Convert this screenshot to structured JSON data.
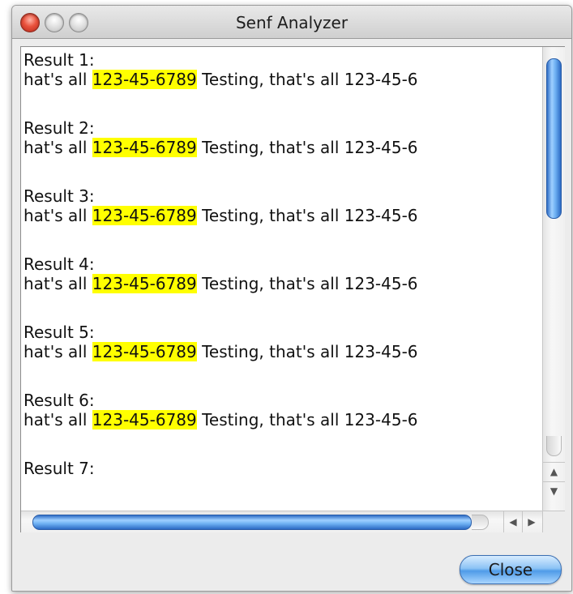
{
  "window": {
    "title": "Senf Analyzer"
  },
  "results": [
    {
      "heading": "Result 1:",
      "prefix": "hat's all ",
      "match": "123-45-6789",
      "suffix": " Testing, that's all 123-45-6"
    },
    {
      "heading": "Result 2:",
      "prefix": "hat's all ",
      "match": "123-45-6789",
      "suffix": " Testing, that's all 123-45-6"
    },
    {
      "heading": "Result 3:",
      "prefix": "hat's all ",
      "match": "123-45-6789",
      "suffix": " Testing, that's all 123-45-6"
    },
    {
      "heading": "Result 4:",
      "prefix": "hat's all ",
      "match": "123-45-6789",
      "suffix": " Testing, that's all 123-45-6"
    },
    {
      "heading": "Result 5:",
      "prefix": "hat's all ",
      "match": "123-45-6789",
      "suffix": " Testing, that's all 123-45-6"
    },
    {
      "heading": "Result 6:",
      "prefix": "hat's all ",
      "match": "123-45-6789",
      "suffix": " Testing, that's all 123-45-6"
    },
    {
      "heading": "Result 7:"
    }
  ],
  "footer": {
    "close_label": "Close"
  },
  "colors": {
    "highlight": "#ffff00",
    "accent": "#4f9be8"
  },
  "icons": {
    "scroll_up": "arrow-up-icon",
    "scroll_down": "arrow-down-icon",
    "scroll_left": "arrow-left-icon",
    "scroll_right": "arrow-right-icon"
  }
}
